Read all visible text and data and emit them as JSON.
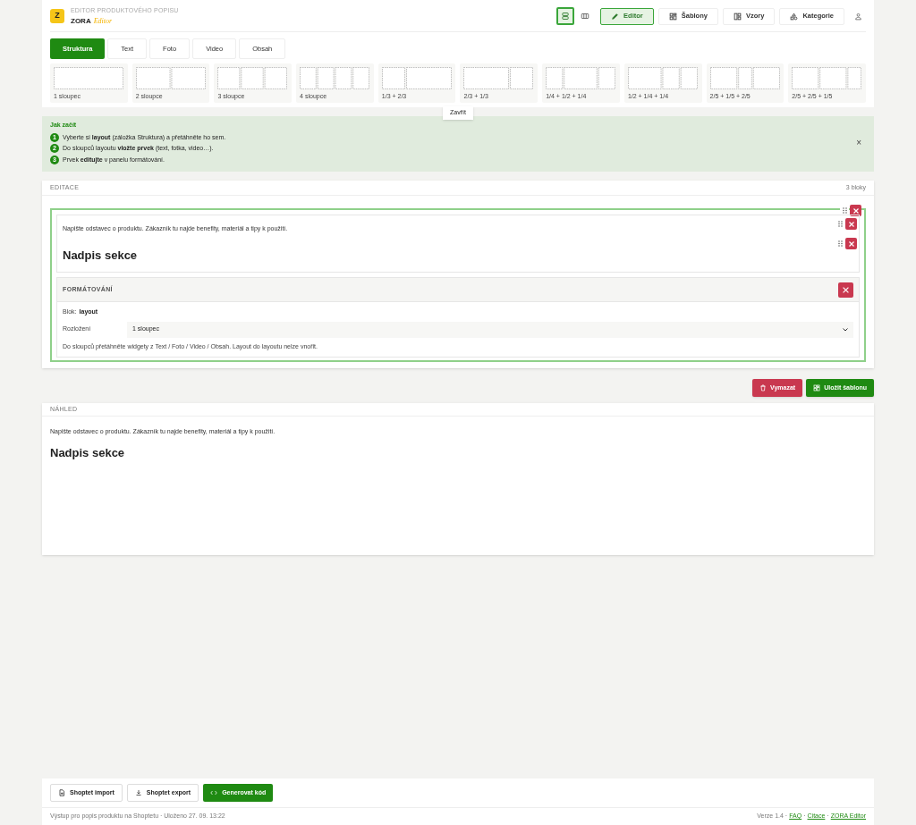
{
  "header": {
    "logo_letter": "Z",
    "subtitle": "EDITOR PRODUKTOVÉHO POPISU",
    "brand": "ZORA",
    "brand_accent": "Editor",
    "view_toggles": [
      {
        "kind": "rows",
        "selected": true
      },
      {
        "kind": "columns",
        "selected": false
      }
    ],
    "nav": [
      {
        "label": "Editor",
        "kind": "pencil",
        "selected": true
      },
      {
        "label": "Šablony",
        "kind": "template",
        "selected": false
      },
      {
        "label": "Vzory",
        "kind": "pattern",
        "selected": false
      },
      {
        "label": "Kategorie",
        "kind": "shapes",
        "selected": false
      }
    ]
  },
  "tabs": [
    {
      "label": "Struktura",
      "selected": true
    },
    {
      "label": "Text",
      "selected": false
    },
    {
      "label": "Foto",
      "selected": false
    },
    {
      "label": "Video",
      "selected": false
    },
    {
      "label": "Obsah",
      "selected": false
    }
  ],
  "layouts": [
    {
      "label": "1 sloupec",
      "kind": "c1"
    },
    {
      "label": "2 sloupce",
      "kind": "c2"
    },
    {
      "label": "3 sloupce",
      "kind": "c3"
    },
    {
      "label": "4 sloupce",
      "kind": "c4"
    },
    {
      "label": "1/3 + 2/3",
      "kind": "c12"
    },
    {
      "label": "2/3 + 1/3",
      "kind": "c21"
    },
    {
      "label": "1/4 + 1/2 + 1/4",
      "kind": "c141"
    },
    {
      "label": "1/2 + 1/4 + 1/4",
      "kind": "c411"
    },
    {
      "label": "2/5 + 1/5 + 2/5",
      "kind": "c212"
    },
    {
      "label": "2/5 + 2/5 + 1/5",
      "kind": "c221"
    }
  ],
  "close_tab": "Zavřít",
  "help": {
    "title": "Jak začít",
    "steps": [
      {
        "number": "1",
        "text": "Vyberte si **layout** (záložka Struktura) a přetáhněte ho sem."
      },
      {
        "number": "2",
        "text": "Do sloupců layoutu **vložte prvek** (text, fotka, video…)."
      },
      {
        "number": "3",
        "text": "Prvek **editujte** v panelu formátování."
      }
    ],
    "close": "×"
  },
  "editor": {
    "title": "EDITACE",
    "count": "3 bloky",
    "block": {
      "paragraph": "Napište odstavec o produktu. Zákazník tu najde benefity, materiál a tipy k použití.",
      "heading": "Nadpis sekce"
    },
    "formatting": {
      "title": "FORMÁTOVÁNÍ",
      "block_label": "Blok:",
      "block_value": "layout",
      "field_label": "Rozložení",
      "field_value": "1 sloupec",
      "hint": "Do sloupců přetáhněte widgety z Text / Foto / Video / Obsah. Layout do layoutu nelze vnořit."
    }
  },
  "actions": [
    {
      "label": "Vymazat",
      "kind": "danger"
    },
    {
      "label": "Uložit šablonu",
      "kind": "primary"
    }
  ],
  "preview": {
    "title": "NÁHLED",
    "paragraph": "Napište odstavec o produktu. Zákazník tu najde benefity, materiál a tipy k použití.",
    "heading": "Nadpis sekce"
  },
  "footer": {
    "buttons": [
      {
        "label": "Shoptet import",
        "kind": "import"
      },
      {
        "label": "Shoptet export",
        "kind": "export"
      },
      {
        "label": "Generovat kód",
        "kind": "code"
      }
    ],
    "status": "Výstup pro popis produktu na Shoptetu · Uloženo 27. 09. 13:22",
    "version": "Verze 1.4 ·",
    "links": [
      {
        "label": "FAQ"
      },
      {
        "separator": "·",
        "label": "Citace"
      },
      {
        "separator": "·",
        "label": "ZORA Editor"
      }
    ]
  }
}
